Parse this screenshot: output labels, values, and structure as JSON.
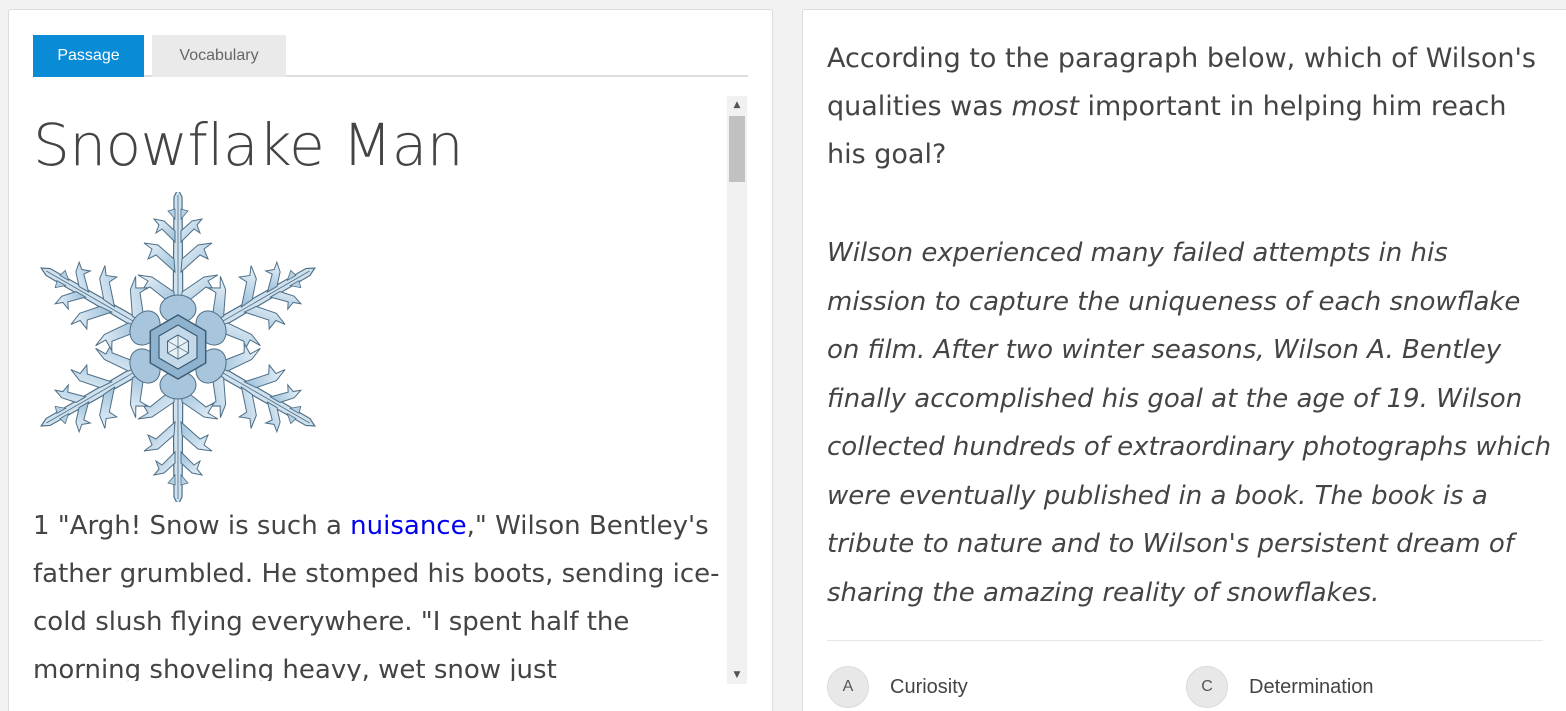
{
  "tabs": [
    {
      "label": "Passage",
      "active": true
    },
    {
      "label": "Vocabulary",
      "active": false
    }
  ],
  "passage": {
    "title": "Snowflake Man",
    "image": "snowflake-illustration",
    "paragraph": {
      "number": "1",
      "pre_link": " \"Argh! Snow is such a ",
      "link_word": "nuisance",
      "post_link": ",\" Wilson Bentley's father grumbled. He stomped his boots, sending ice-cold slush flying everywhere. \"I spent half the morning shoveling heavy, wet snow just"
    }
  },
  "question": {
    "prompt_before": "According to the paragraph below, which of Wilson's qualities was ",
    "prompt_emphasis": "most",
    "prompt_after": " important in helping him reach his goal?",
    "excerpt": "Wilson experienced many failed attempts in his mission to capture the uniqueness of each snowflake on film. After two winter seasons, Wilson A. Bentley finally accomplished his goal at the age of 19. Wilson collected hundreds of extraordinary photographs which were eventually published in a book. The book is a tribute to nature and to Wilson's persistent dream of sharing the amazing reality of snowflakes."
  },
  "choices": [
    {
      "letter": "A",
      "label": "Curiosity"
    },
    {
      "letter": "C",
      "label": "Determination"
    }
  ],
  "colors": {
    "accent": "#0a8bd6",
    "link": "#0000ee",
    "text": "#444444"
  },
  "icons": {
    "scroll_up": "scroll-up-arrow-icon",
    "scroll_down": "scroll-down-arrow-icon"
  }
}
